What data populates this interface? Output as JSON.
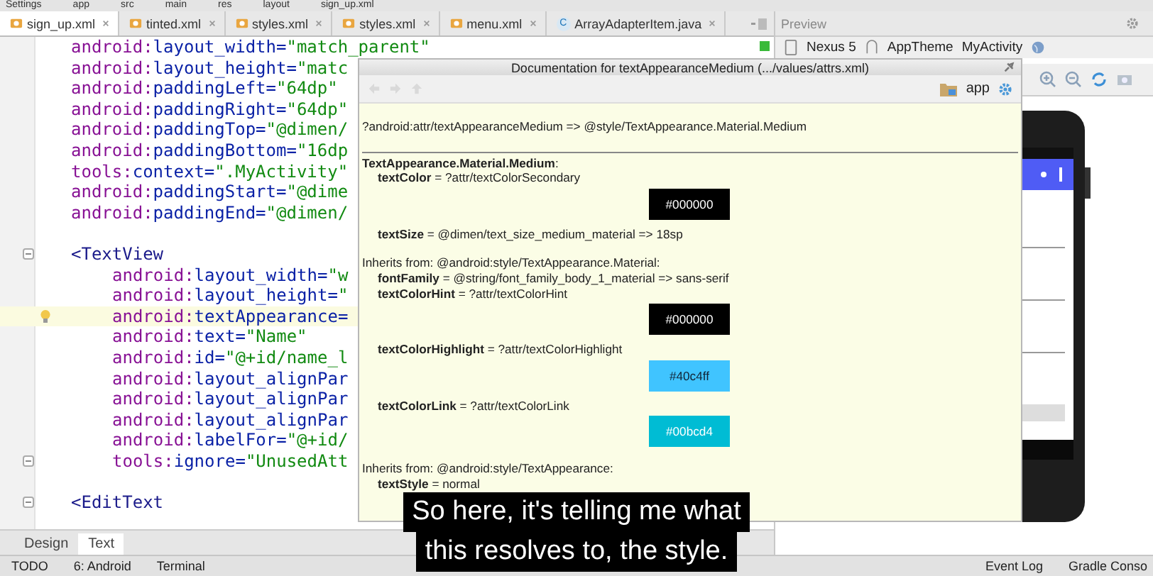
{
  "breadcrumbs": [
    "Settings",
    "app",
    "src",
    "main",
    "res",
    "layout",
    "sign_up.xml"
  ],
  "editor_tabs": [
    {
      "label": "sign_up.xml",
      "kind": "xml",
      "selected": true
    },
    {
      "label": "tinted.xml",
      "kind": "xml",
      "selected": false
    },
    {
      "label": "styles.xml",
      "kind": "xml",
      "selected": false
    },
    {
      "label": "styles.xml",
      "kind": "xml",
      "selected": false
    },
    {
      "label": "menu.xml",
      "kind": "xml",
      "selected": false
    },
    {
      "label": "ArrayAdapterItem.java",
      "kind": "class",
      "letter": "C",
      "selected": false
    }
  ],
  "code_lines": [
    {
      "kind": "attr",
      "ns": "android:",
      "name": "layout_width=",
      "value": "\"match_parent\"",
      "highlighted": false,
      "fold": false
    },
    {
      "kind": "attr",
      "ns": "android:",
      "name": "layout_height=",
      "value": "\"matc",
      "highlighted": false,
      "fold": false
    },
    {
      "kind": "attr",
      "ns": "android:",
      "name": "paddingLeft=",
      "value": "\"64dp\"",
      "highlighted": false,
      "fold": false
    },
    {
      "kind": "attr",
      "ns": "android:",
      "name": "paddingRight=",
      "value": "\"64dp\"",
      "highlighted": false,
      "fold": false
    },
    {
      "kind": "attr",
      "ns": "android:",
      "name": "paddingTop=",
      "value": "\"@dimen/",
      "highlighted": false,
      "fold": false
    },
    {
      "kind": "attr",
      "ns": "android:",
      "name": "paddingBottom=",
      "value": "\"16dp",
      "highlighted": false,
      "fold": false
    },
    {
      "kind": "attr",
      "ns": "tools:",
      "name": "context=",
      "value": "\".MyActivity\"",
      "highlighted": false,
      "fold": false
    },
    {
      "kind": "attr",
      "ns": "android:",
      "name": "paddingStart=",
      "value": "\"@dime",
      "highlighted": false,
      "fold": false
    },
    {
      "kind": "attr",
      "ns": "android:",
      "name": "paddingEnd=",
      "value": "\"@dimen/",
      "highlighted": false,
      "fold": false
    },
    {
      "kind": "blank"
    },
    {
      "kind": "tag",
      "text": "<TextView",
      "highlighted": false,
      "fold": true,
      "children": [
        {
          "kind": "attr",
          "ns": "android:",
          "name": "layout_width=",
          "value": "\"w",
          "highlighted": false,
          "fold": false
        },
        {
          "kind": "attr",
          "ns": "android:",
          "name": "layout_height=",
          "value": "\"",
          "highlighted": false,
          "fold": false
        },
        {
          "kind": "attr",
          "ns": "android:",
          "name": "textAppearance=",
          "highlighted": true,
          "fold": false
        },
        {
          "kind": "attr",
          "ns": "android:",
          "name": "text=",
          "value": "\"Name\"",
          "highlighted": false,
          "fold": false
        },
        {
          "kind": "attr",
          "ns": "android:",
          "name": "id=",
          "value": "\"@+id/name_l",
          "highlighted": false,
          "fold": false
        },
        {
          "kind": "attr",
          "ns": "android:",
          "name": "layout_alignPar",
          "highlighted": false,
          "fold": false
        },
        {
          "kind": "attr",
          "ns": "android:",
          "name": "layout_alignPar",
          "highlighted": false,
          "fold": false
        },
        {
          "kind": "attr",
          "ns": "android:",
          "name": "layout_alignPar",
          "highlighted": false,
          "fold": false
        },
        {
          "kind": "attr",
          "ns": "android:",
          "name": "labelFor=",
          "value": "\"@+id/",
          "highlighted": false,
          "fold": false
        },
        {
          "kind": "attr",
          "ns": "tools:",
          "name": "ignore=",
          "value": "\"UnusedAtt",
          "highlighted": false,
          "fold": true
        }
      ]
    },
    {
      "kind": "blank"
    },
    {
      "kind": "tag",
      "text": "<EditText",
      "highlighted": false,
      "fold": true
    }
  ],
  "view_tabs": [
    {
      "label": "Design",
      "selected": false
    },
    {
      "label": "Text",
      "selected": true
    }
  ],
  "preview": {
    "title": "Preview",
    "device": "Nexus 5",
    "theme": "AppTheme",
    "activity": "MyActivity"
  },
  "documentation": {
    "title": "Documentation for textAppearanceMedium (.../values/attrs.xml)",
    "project": "app",
    "header": "?android:attr/textAppearanceMedium => @style/TextAppearance.Material.Medium",
    "sections": [
      {
        "heading": "**TextAppearance.Material.Medium**:",
        "properties": [
          {
            "name": "textColor",
            "value": "= ?attr/textColorSecondary",
            "swatch": "#000000"
          },
          {
            "name": "textSize",
            "value": "= @dimen/text_size_medium_material => 18sp"
          }
        ]
      },
      {
        "heading": "Inherits from: @android:style/TextAppearance.Material:",
        "properties": [
          {
            "name": "fontFamily",
            "value": "= @string/font_family_body_1_material => sans-serif"
          },
          {
            "name": "textColorHint",
            "value": "= ?attr/textColorHint",
            "swatch": "#000000"
          },
          {
            "name": "textColorHighlight",
            "value": "= ?attr/textColorHighlight",
            "swatch": "#40c4ff"
          },
          {
            "name": "textColorLink",
            "value": "= ?attr/textColorLink",
            "swatch": "#00bcd4"
          }
        ]
      },
      {
        "heading": "Inherits from: @android:style/TextAppearance:",
        "properties": [
          {
            "name": "textStyle",
            "value": "= normal"
          }
        ]
      }
    ]
  },
  "caption": [
    "So here, it's telling me what",
    "this resolves to, the style."
  ],
  "status_bar": {
    "left": [
      "TODO",
      "6: Android",
      "Terminal"
    ],
    "right": [
      "Event Log",
      "Gradle Conso"
    ]
  }
}
